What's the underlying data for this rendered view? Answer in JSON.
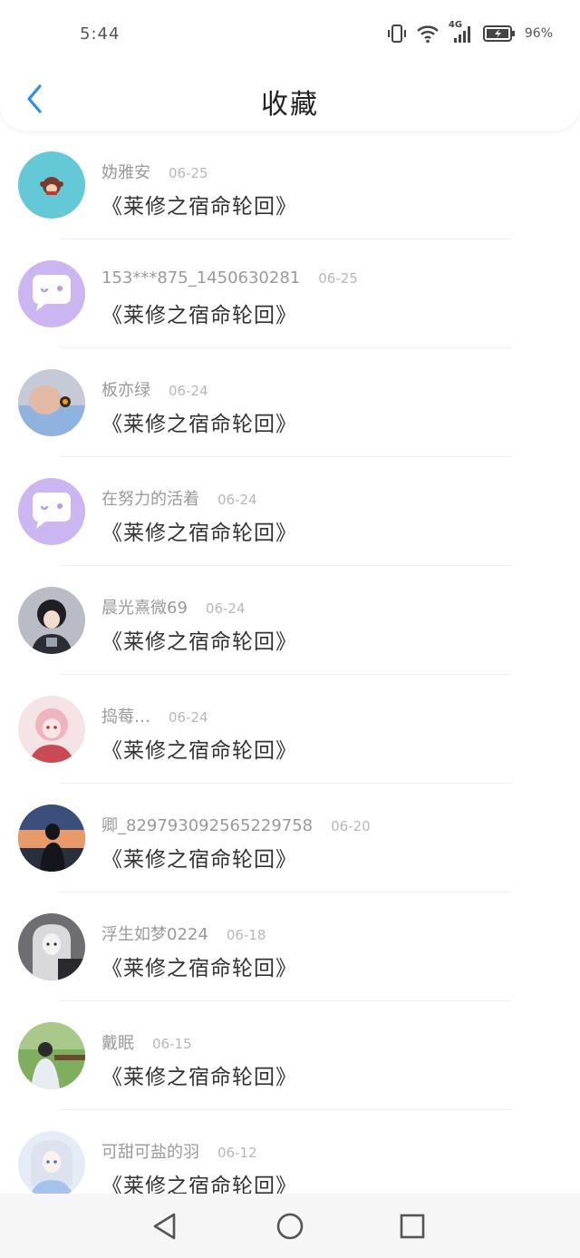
{
  "status_bar": {
    "time": "5:44",
    "network": "4G",
    "battery": "96%"
  },
  "header": {
    "title": "收藏",
    "back_icon": "chevron-left-icon"
  },
  "colors": {
    "accent": "#2f8fdc",
    "text_primary": "#333333",
    "text_secondary": "#9a9a9a",
    "text_date": "#b8b8b8"
  },
  "favorites": [
    {
      "user": "妫雅安",
      "date": "06-25",
      "title": "《莱修之宿命轮回》",
      "avatar": "monkey-avatar"
    },
    {
      "user": "153***875_1450630281",
      "date": "06-25",
      "title": "《莱修之宿命轮回》",
      "avatar": "default-chat-avatar"
    },
    {
      "user": "板亦绿",
      "date": "06-24",
      "title": "《莱修之宿命轮回》",
      "avatar": "photo-avatar"
    },
    {
      "user": "在努力的活着",
      "date": "06-24",
      "title": "《莱修之宿命轮回》",
      "avatar": "default-chat-avatar"
    },
    {
      "user": "晨光熹微69",
      "date": "06-24",
      "title": "《莱修之宿命轮回》",
      "avatar": "anime-avatar"
    },
    {
      "user": "捣莓…",
      "date": "06-24",
      "title": "《莱修之宿命轮回》",
      "avatar": "anime-pink-avatar"
    },
    {
      "user": "卿_829793092565229758",
      "date": "06-20",
      "title": "《莱修之宿命轮回》",
      "avatar": "sunset-avatar"
    },
    {
      "user": "浮生如梦0224",
      "date": "06-18",
      "title": "《莱修之宿命轮回》",
      "avatar": "anime-grey-avatar"
    },
    {
      "user": "戴眠",
      "date": "06-15",
      "title": "《莱修之宿命轮回》",
      "avatar": "outdoor-avatar"
    },
    {
      "user": "可甜可盐的羽",
      "date": "06-12",
      "title": "《莱修之宿命轮回》",
      "avatar": "anime-blue-avatar"
    }
  ],
  "system_nav": {
    "back": "triangle-back-icon",
    "home": "circle-home-icon",
    "recents": "square-recents-icon"
  }
}
